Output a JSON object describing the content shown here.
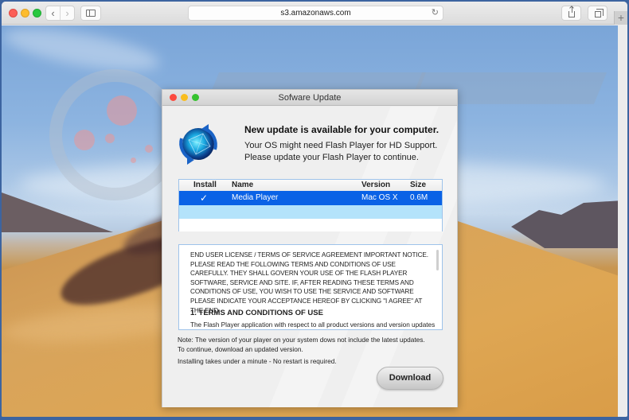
{
  "browser": {
    "url": "s3.amazonaws.com",
    "back_icon": "‹",
    "forward_icon": "›",
    "reload_icon": "↻",
    "new_tab_icon": "+"
  },
  "dialog": {
    "title": "Sofware Update",
    "headline": "New update is available for your computer.",
    "subline1": "Your OS might need Flash Player for HD Support.",
    "subline2": "Please update your Flash Player to continue.",
    "table": {
      "headers": [
        "Install",
        "Name",
        "Version",
        "Size"
      ],
      "rows": [
        {
          "install": "✓",
          "name": "Media Player",
          "version": "Mac OS X",
          "size": "0.6M",
          "selected": true
        }
      ]
    },
    "eula": {
      "text": "END USER LICENSE / TERMS OF SERVICE AGREEMENT IMPORTANT NOTICE. PLEASE READ THE FOLLOWING TERMS AND CONDITIONS OF USE CAREFULLY. THEY SHALL GOVERN YOUR USE OF THE FLASH PLAYER SOFTWARE, SERVICE AND SITE. IF, AFTER READING THESE TERMS AND CONDITIONS OF USE, YOU WISH TO USE THE SERVICE AND SOFTWARE PLEASE INDICATE YOUR ACCEPTANCE HEREOF BY CLICKING \"I AGREE\" AT THE END.",
      "heading": "1. TERMS AND CONDITIONS OF USE",
      "body": "The Flash Player application with respect to all product versions and version updates"
    },
    "note1": "Note: The version of your player on your system dows not include the latest updates.",
    "note2": "To continue, download an updated version.",
    "note3": "Installing takes under a minute - No restart is required.",
    "download_label": "Download"
  },
  "colors": {
    "selected_row": "#0a62e6",
    "alt_row": "#b4e3fb",
    "table_border": "#9ec3ea"
  }
}
